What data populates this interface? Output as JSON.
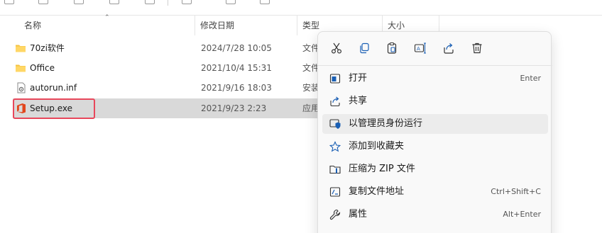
{
  "columns": {
    "name": "名称",
    "modified": "修改日期",
    "type": "类型",
    "size": "大小"
  },
  "files": [
    {
      "name": "70zi软件",
      "date": "2024/7/28 10:05",
      "type": "文件",
      "icon": "folder-icon"
    },
    {
      "name": "Office",
      "date": "2021/10/4 15:31",
      "type": "文件",
      "icon": "folder-icon"
    },
    {
      "name": "autorun.inf",
      "date": "2021/9/16 18:03",
      "type": "安装",
      "icon": "inf-file-icon"
    },
    {
      "name": "Setup.exe",
      "date": "2021/9/23 2:23",
      "type": "应用",
      "icon": "office-setup-icon"
    }
  ],
  "context_menu": {
    "toolbar": [
      "cut-icon",
      "copy-icon",
      "paste-icon",
      "rename-icon",
      "share-icon",
      "delete-icon"
    ],
    "items": [
      {
        "label": "打开",
        "shortcut": "Enter",
        "icon": "open-app-icon"
      },
      {
        "label": "共享",
        "shortcut": "",
        "icon": "share-icon"
      },
      {
        "label": "以管理员身份运行",
        "shortcut": "",
        "icon": "run-as-admin-icon"
      },
      {
        "label": "添加到收藏夹",
        "shortcut": "",
        "icon": "star-icon"
      },
      {
        "label": "压缩为 ZIP 文件",
        "shortcut": "",
        "icon": "zip-icon"
      },
      {
        "label": "复制文件地址",
        "shortcut": "Ctrl+Shift+C",
        "icon": "copy-path-icon"
      },
      {
        "label": "属性",
        "shortcut": "Alt+Enter",
        "icon": "properties-icon"
      }
    ]
  },
  "colors": {
    "selection": "#d9d9d9",
    "highlight_border": "#e8475b",
    "folder": "#f5c342",
    "office": "#e2461d",
    "accent": "#1a5fb4"
  }
}
